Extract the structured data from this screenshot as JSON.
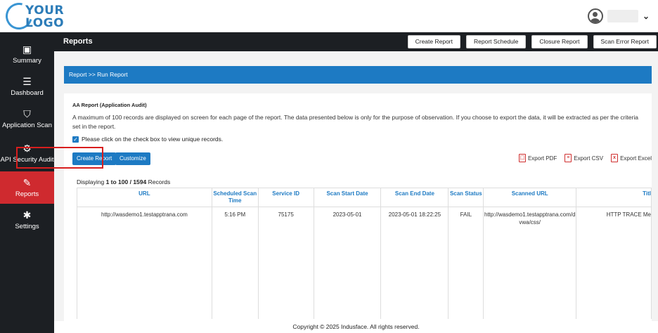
{
  "logo": {
    "line1": "YOUR",
    "line2": "LOGO"
  },
  "header": {
    "title": "Reports",
    "buttons": [
      "Create Report",
      "Report Schedule",
      "Closure Report",
      "Scan Error Report"
    ]
  },
  "sidebar": {
    "items": [
      {
        "label": "Summary",
        "icon": "summary-icon"
      },
      {
        "label": "Dashboard",
        "icon": "dashboard-icon"
      },
      {
        "label": "Application Scan",
        "icon": "shield-icon"
      },
      {
        "label": "API Security Audit",
        "icon": "api-icon"
      },
      {
        "label": "Reports",
        "icon": "edit-icon"
      },
      {
        "label": "Settings",
        "icon": "gear-icon"
      }
    ]
  },
  "breadcrumb": "Report >> Run Report",
  "panel": {
    "title": "AA Report (Application Audit)",
    "description": "A maximum of 100 records are displayed on screen for each page of the report. The data presented below is only for the purpose of observation. If you choose to export the data, it will be extracted as per the criteria set in the report.",
    "checkbox_label": "Please click on the check box to view unique records.",
    "create_report": "Create Report",
    "customize": "Customize",
    "exports": [
      "Export PDF",
      "Export CSV",
      "Export Excel"
    ],
    "displaying_prefix": "Displaying ",
    "displaying_range": "1 to 100 / 1594",
    "displaying_suffix": " Records"
  },
  "table": {
    "headers": [
      "URL",
      "Scheduled Scan Time",
      "Service ID",
      "Scan Start Date",
      "Scan End Date",
      "Scan Status",
      "Scanned URL",
      "Titl"
    ],
    "rows": [
      [
        "http://wasdemo1.testapptrana.com",
        "5:16 PM",
        "75175",
        "2023-05-01",
        "2023-05-01 18:22:25",
        "FAIL",
        "http://wasdemo1.testapptrana.com/dvwa/css/",
        "HTTP TRACE Me"
      ]
    ]
  },
  "footer": "Copyright © 2025 Indusface. All rights reserved.",
  "colors": {
    "accent": "#1d7ac3",
    "active_nav": "#cf2a2f",
    "highlight": "#d81e1e"
  }
}
